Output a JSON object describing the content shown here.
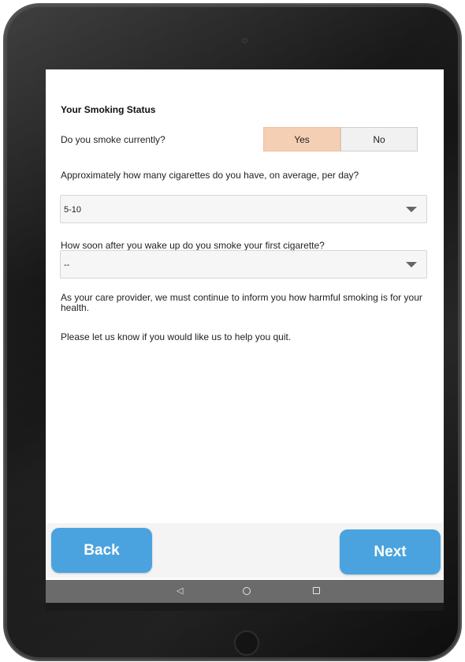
{
  "page": {
    "title": "Your Smoking Status"
  },
  "questions": {
    "q1": {
      "label": "Do you smoke currently?",
      "options": [
        "Yes",
        "No"
      ],
      "selected": "Yes"
    },
    "q2": {
      "label": "Approximately how many cigarettes do you have, on average, per day?",
      "value": "5-10"
    },
    "q3": {
      "label": "How soon after you wake up do you smoke your first cigarette?",
      "value": "--"
    }
  },
  "info": {
    "line1": "As your care provider, we must continue to inform you how harmful smoking is for your health.",
    "line2": "Please let us know if you would like us to help you quit."
  },
  "navigation": {
    "back_label": "Back",
    "next_label": "Next"
  },
  "system_bar": {
    "back_icon": "◁",
    "home_icon": "circle-icon",
    "recents_icon": "square-icon"
  },
  "colors": {
    "accent": "#4aa3de",
    "selected_option": "#f5cfb3"
  }
}
